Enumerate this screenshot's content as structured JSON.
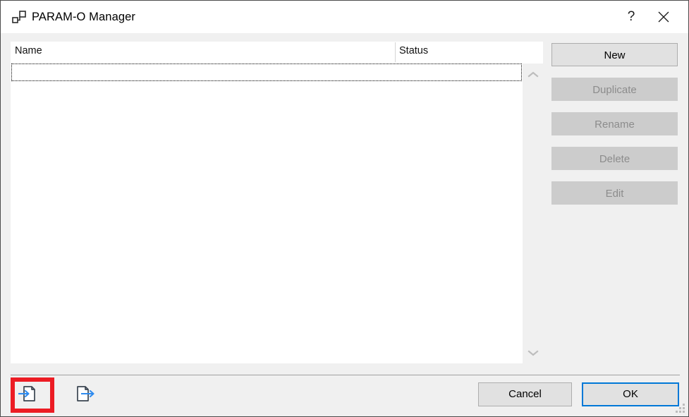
{
  "window": {
    "title": "PARAM-O Manager",
    "icon": "nodes-icon",
    "help_label": "?",
    "close_label": "✕"
  },
  "list": {
    "columns": [
      {
        "label": "Name"
      },
      {
        "label": "Status"
      }
    ],
    "rows": [],
    "scrollbar": {
      "up_arrow": "chevron-up-icon",
      "down_arrow": "chevron-down-icon"
    }
  },
  "side_buttons": [
    {
      "label": "New",
      "enabled": true
    },
    {
      "label": "Duplicate",
      "enabled": false
    },
    {
      "label": "Rename",
      "enabled": false
    },
    {
      "label": "Delete",
      "enabled": false
    },
    {
      "label": "Edit",
      "enabled": false
    }
  ],
  "toolbar": {
    "import_icon": "import-document-icon",
    "export_icon": "export-document-icon"
  },
  "footer": {
    "cancel_label": "Cancel",
    "ok_label": "OK"
  },
  "colors": {
    "accent": "#0078d7",
    "highlight": "#ec1c24",
    "icon_blue": "#2e8bef",
    "dialog_bg": "#f0f0f0",
    "button_enabled": "#e1e1e1",
    "button_disabled": "#cccccc",
    "disabled_text": "#8c8c8c"
  }
}
